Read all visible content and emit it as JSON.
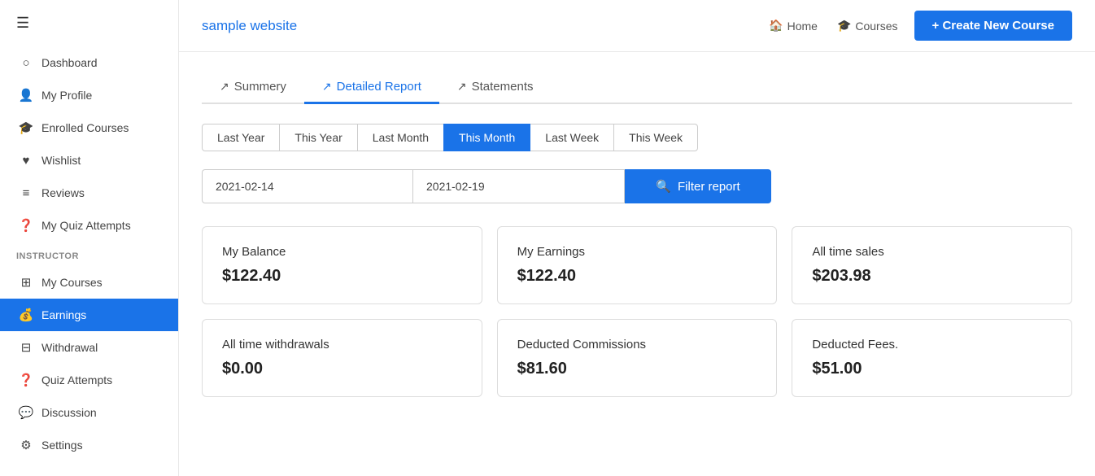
{
  "header": {
    "brand": "sample website",
    "nav": [
      {
        "label": "Home",
        "icon": "🏠"
      },
      {
        "label": "Courses",
        "icon": "🎓"
      }
    ],
    "create_btn": "+ Create New Course"
  },
  "sidebar": {
    "hamburger": "☰",
    "items": [
      {
        "label": "Dashboard",
        "icon": "○",
        "section": null,
        "active": false
      },
      {
        "label": "My Profile",
        "icon": "👤",
        "section": null,
        "active": false
      },
      {
        "label": "Enrolled Courses",
        "icon": "🎓",
        "section": null,
        "active": false
      },
      {
        "label": "Wishlist",
        "icon": "♥",
        "section": null,
        "active": false
      },
      {
        "label": "Reviews",
        "icon": "≡",
        "section": null,
        "active": false
      },
      {
        "label": "My Quiz Attempts",
        "icon": "?",
        "section": null,
        "active": false
      },
      {
        "label": "INSTRUCTOR",
        "section_label": true
      },
      {
        "label": "My Courses",
        "icon": "⊞",
        "section": "INSTRUCTOR",
        "active": false
      },
      {
        "label": "Earnings",
        "icon": "💰",
        "section": "INSTRUCTOR",
        "active": true
      },
      {
        "label": "Withdrawal",
        "icon": "⊟",
        "section": "INSTRUCTOR",
        "active": false
      },
      {
        "label": "Quiz Attempts",
        "icon": "?",
        "section": "INSTRUCTOR",
        "active": false
      },
      {
        "label": "Discussion",
        "icon": "💬",
        "section": "INSTRUCTOR",
        "active": false
      },
      {
        "label": "Settings",
        "icon": "⚙",
        "section": "INSTRUCTOR",
        "active": false
      }
    ]
  },
  "tabs": [
    {
      "label": "Summery",
      "active": false
    },
    {
      "label": "Detailed Report",
      "active": true
    },
    {
      "label": "Statements",
      "active": false
    }
  ],
  "period_filters": [
    {
      "label": "Last Year",
      "active": false
    },
    {
      "label": "This Year",
      "active": false
    },
    {
      "label": "Last Month",
      "active": false
    },
    {
      "label": "This Month",
      "active": true
    },
    {
      "label": "Last Week",
      "active": false
    },
    {
      "label": "This Week",
      "active": false
    }
  ],
  "date_filter": {
    "start": "2021-02-14",
    "end": "2021-02-19",
    "button": "Filter report"
  },
  "stats": [
    {
      "title": "My Balance",
      "value": "$122.40"
    },
    {
      "title": "My Earnings",
      "value": "$122.40"
    },
    {
      "title": "All time sales",
      "value": "$203.98"
    },
    {
      "title": "All time withdrawals",
      "value": "$0.00"
    },
    {
      "title": "Deducted Commissions",
      "value": "$81.60"
    },
    {
      "title": "Deducted Fees.",
      "value": "$51.00"
    }
  ]
}
